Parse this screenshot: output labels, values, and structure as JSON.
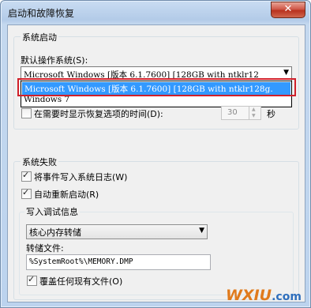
{
  "window": {
    "title": "启动和故障恢复",
    "close_glyph": "✕"
  },
  "system_startup": {
    "group_title": "系统启动",
    "default_os_label": "默认操作系统(S):",
    "default_os_value": "Microsoft Windows [版本 6.1.7600] [128GB with ntklr12",
    "dropdown_arrow": "▼",
    "dropdown_selected": "Microsoft Windows [版本 6.1.7600] [128GB with ntklr128g.",
    "partial_option": "Windows 7",
    "show_recovery_label": "在需要时显示恢复选项的时间(D):",
    "show_recovery_checked": false,
    "recovery_seconds": "30",
    "seconds_unit": "秒"
  },
  "system_failure": {
    "group_title": "系统失败",
    "write_event_label": "将事件写入系统日志(W)",
    "write_event_checked": true,
    "auto_restart_label": "自动重新启动(R)",
    "auto_restart_checked": true,
    "debug_group_title": "写入调试信息",
    "debug_type_value": "核心内存转储",
    "dropdown_arrow": "▼",
    "dump_file_label": "转储文件:",
    "dump_file_value": "%SystemRoot%\\MEMORY.DMP",
    "overwrite_label": "覆盖任何现有文件(O)",
    "overwrite_checked": true
  },
  "watermark": {
    "main": "WXIU",
    "sub": ".com"
  },
  "colors": {
    "selection": "#3399ff",
    "highlight_outline": "#d0202a",
    "watermark": "#e07a1c"
  }
}
